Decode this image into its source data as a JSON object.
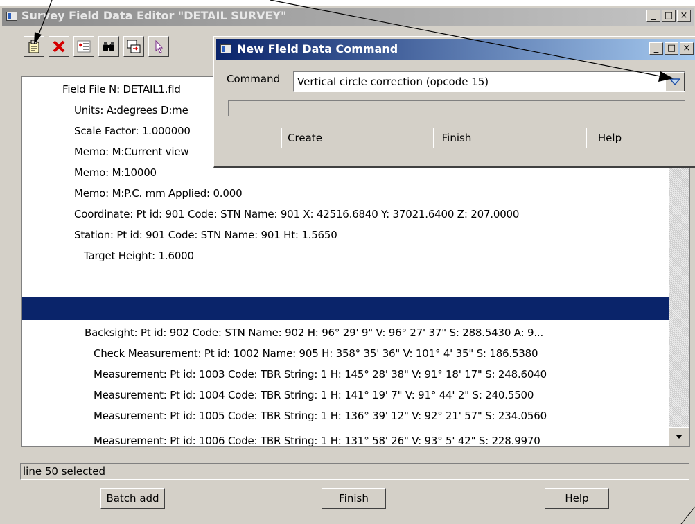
{
  "main_window": {
    "title": "Survey Field Data Editor \"DETAIL SURVEY\"",
    "caption_buttons": {
      "minimize": "_",
      "maximize": "□",
      "close": "×"
    },
    "toolbar": [
      "new-command-icon",
      "delete-icon",
      "edit-properties-icon",
      "find-icon",
      "insert-icon",
      "select-pointer-icon"
    ],
    "list_rows": [
      "Field File N: DETAIL1.fld",
      "Units:  A:degrees D:me",
      "Scale Factor:  1.000000",
      "Memo:  M:Current view",
      "Memo:  M:10000",
      "Memo:  M:P.C. mm Applied: 0.000",
      "Coordinate:  Pt id: 901 Code: STN Name: 901 X: 42516.6840 Y: 37021.6400 Z: 207.0000",
      "Station:  Pt id: 901 Code: STN Name: 901 Ht: 1.5650",
      "Target Height:  1.6000",
      "",
      "Backsight:  Pt id: 902 Code: STN Name: 902 H:   96° 29'  9\" V:   96° 27' 37\" S: 288.5430 A:  9...",
      "Check Measurement:  Pt id: 1002 Name: 905 H:  358° 35' 36\" V:  101°  4' 35\" S: 186.5380",
      "Measurement:  Pt id: 1003 Code: TBR String: 1 H:  145° 28' 38\" V:   91° 18' 17\" S: 248.6040",
      "Measurement:  Pt id: 1004 Code: TBR String: 1 H:  141° 19'  7\" V:   91° 44'  2\" S: 240.5500",
      "Measurement:  Pt id: 1005 Code: TBR String: 1 H:  136° 39' 12\" V:   92° 21' 57\" S: 234.0560",
      "Measurement:  Pt id: 1006 Code: TBR String: 1 H:  131° 58' 26\" V:   93°  5' 42\" S: 228.9970"
    ],
    "selected_row_index": 9,
    "status_text": "line 50 selected",
    "buttons": {
      "batch_add": "Batch add",
      "finish": "Finish",
      "help": "Help"
    }
  },
  "dialog": {
    "title": "New Field Data Command",
    "command_label": "Command",
    "command_value": "Vertical circle correction (opcode 15)",
    "buttons": {
      "create": "Create",
      "finish": "Finish",
      "help": "Help"
    }
  },
  "colors": {
    "selection": "#0a246a",
    "face": "#d4d0c8",
    "active_title": "#0a246a",
    "inactive_title": "#8c8c8c"
  }
}
